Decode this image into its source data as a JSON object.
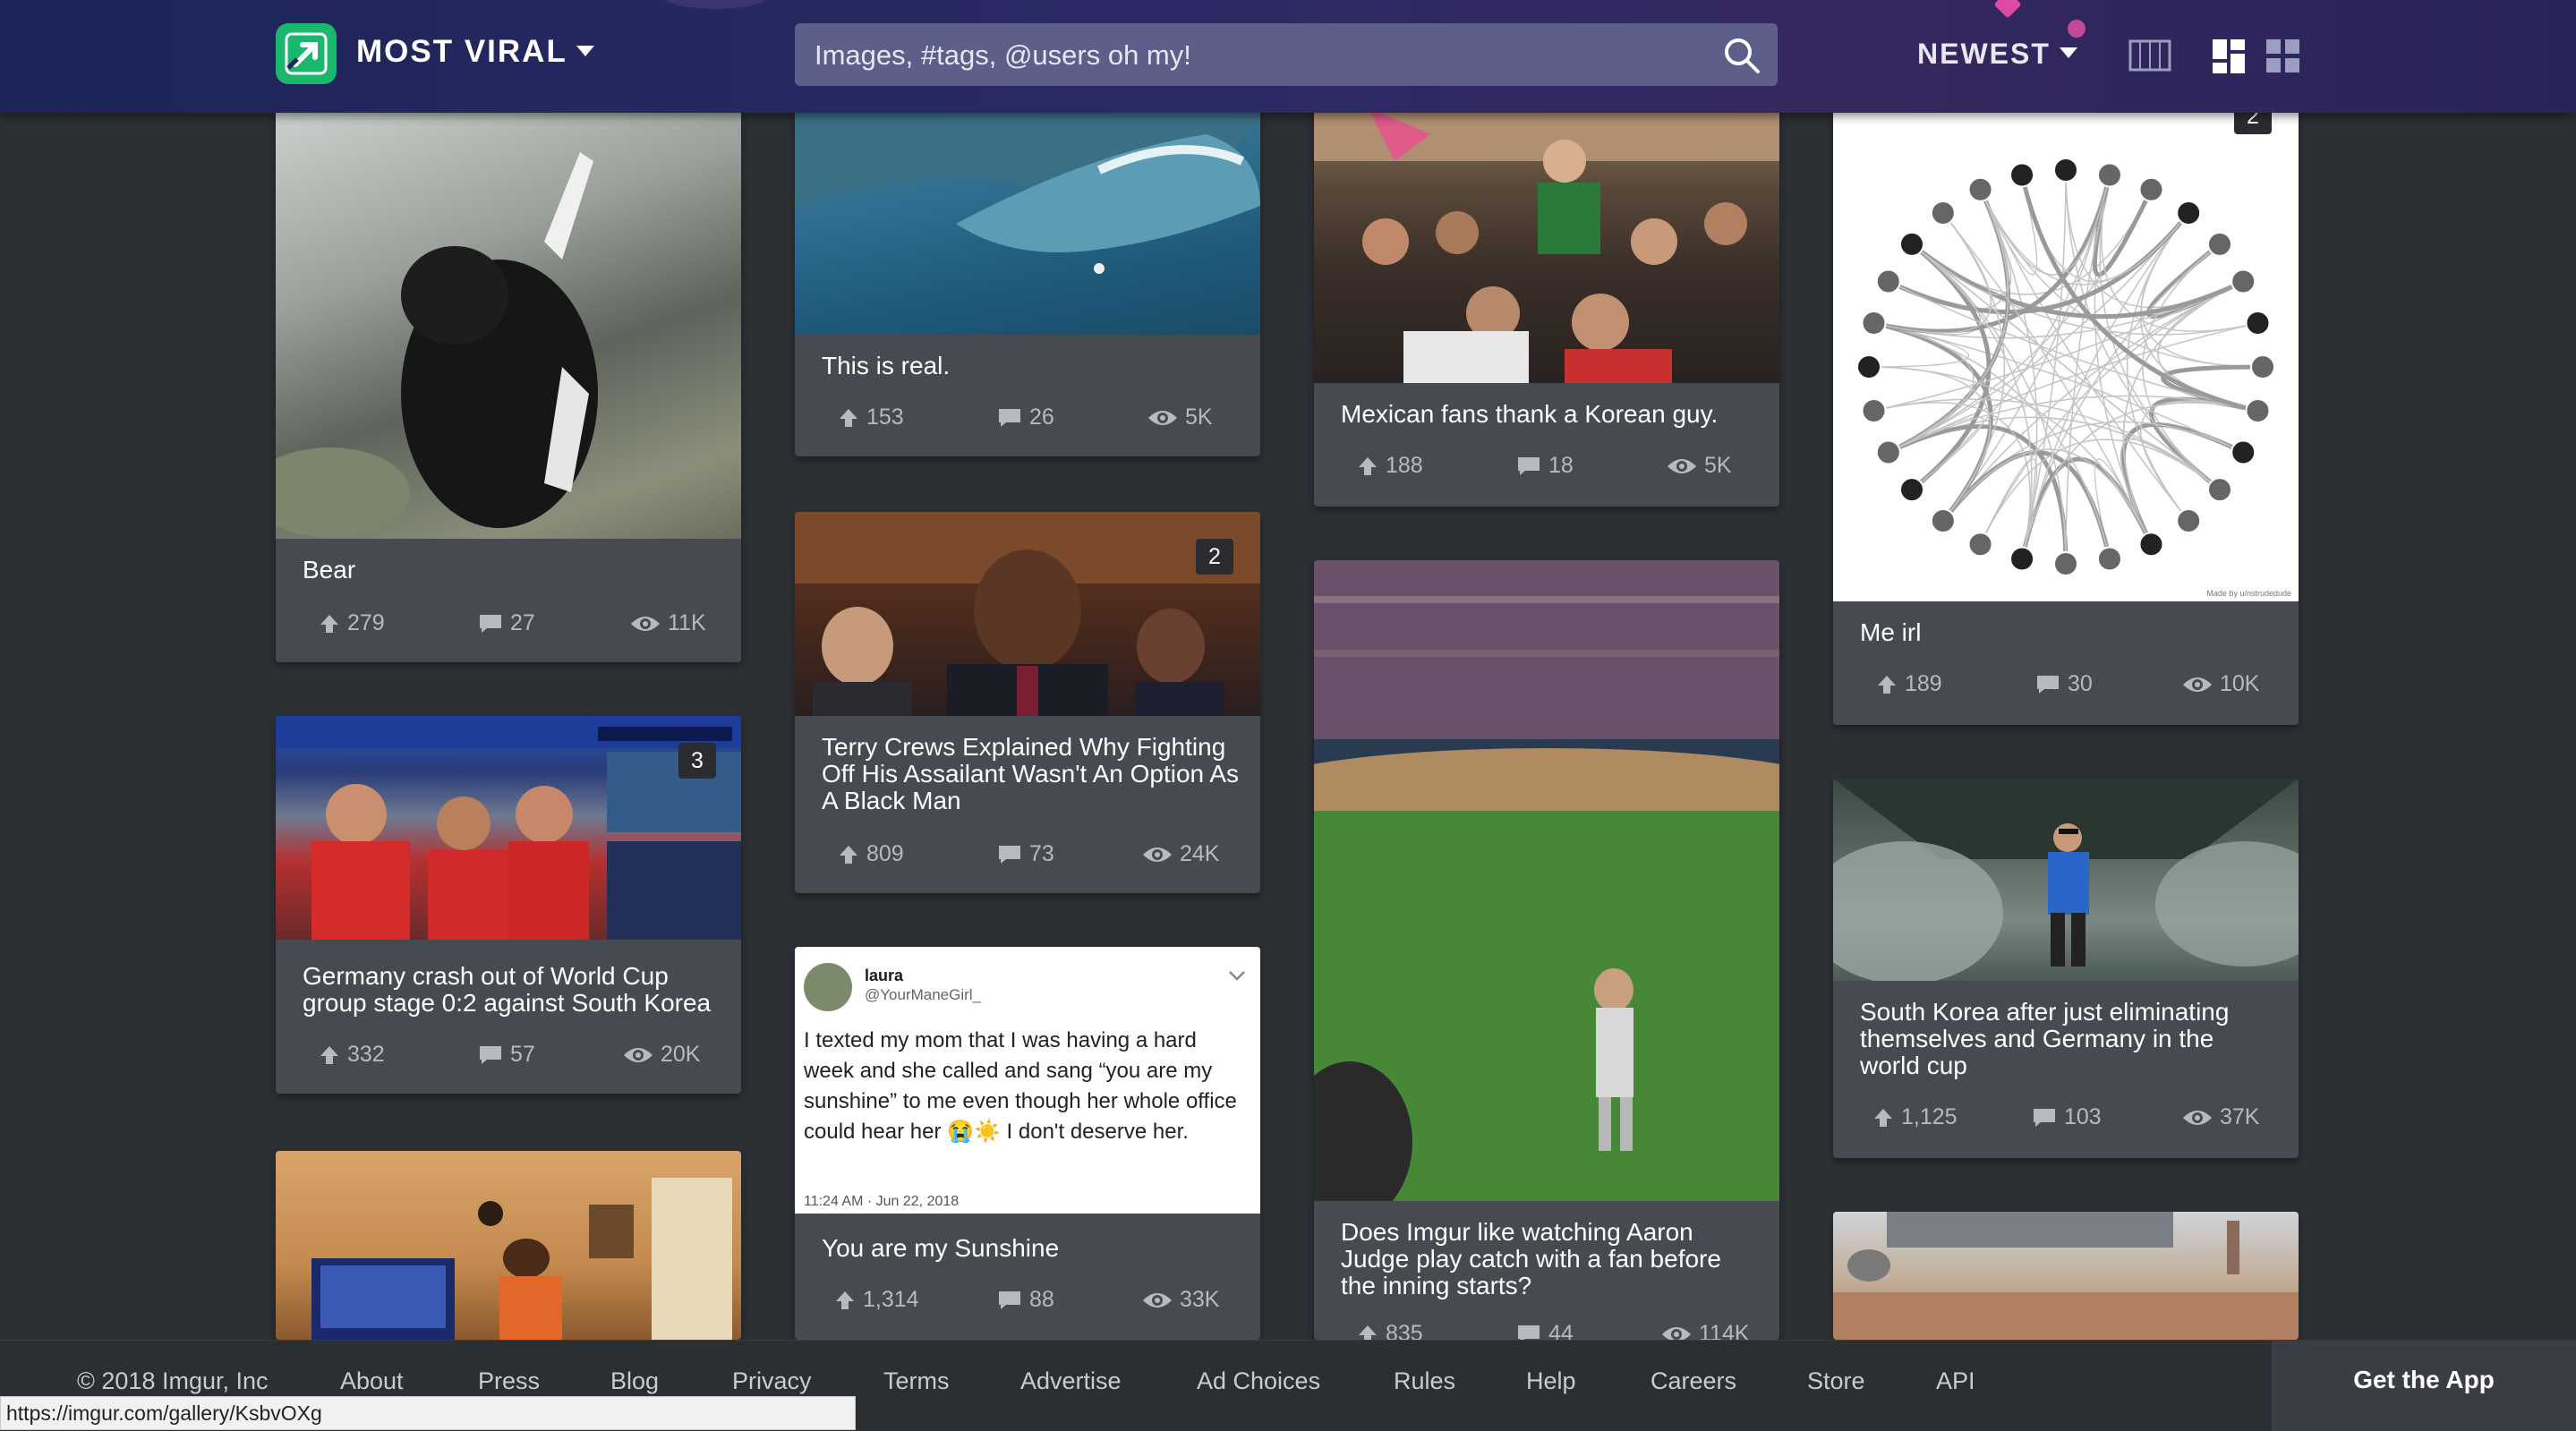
{
  "header": {
    "section_title": "MOST VIRAL",
    "search_placeholder": "Images, #tags, @users oh my!",
    "sort_label": "NEWEST"
  },
  "posts": [
    {
      "title": "Bear",
      "upvotes": "279",
      "comments": "27",
      "views": "11K"
    },
    {
      "title": "Germany crash out of World Cup group stage 0:2 against South Korea",
      "upvotes": "332",
      "comments": "57",
      "views": "20K",
      "badge": "3"
    },
    {
      "title": "This is real.",
      "upvotes": "153",
      "comments": "26",
      "views": "5K"
    },
    {
      "title": "Terry Crews Explained Why Fighting Off His Assailant Wasn't An Option As A Black Man",
      "upvotes": "809",
      "comments": "73",
      "views": "24K",
      "badge": "2"
    },
    {
      "title": "You are my Sunshine",
      "upvotes": "1,314",
      "comments": "88",
      "views": "33K",
      "tweet": {
        "name": "laura",
        "handle": "@YourManeGirl_",
        "text": "I texted my mom that I was having a hard week and she called and sang “you are my sunshine” to me even though her whole office could hear her 😭☀️ I don't deserve her.",
        "time": "11:24 AM · Jun 22, 2018"
      }
    },
    {
      "title": "Mexican fans thank a Korean guy.",
      "upvotes": "188",
      "comments": "18",
      "views": "5K"
    },
    {
      "title": "Does Imgur like watching Aaron Judge play catch with a fan before the inning starts?",
      "upvotes": "835",
      "comments": "44",
      "views": "114K"
    },
    {
      "title": "Me irl",
      "upvotes": "189",
      "comments": "30",
      "views": "10K",
      "badge": "2",
      "image_caption": "Made by u/nstrudedude"
    },
    {
      "title": "South Korea after just eliminating themselves and Germany in the world cup",
      "upvotes": "1,125",
      "comments": "103",
      "views": "37K"
    }
  ],
  "footer": {
    "copyright": "© 2018 Imgur, Inc",
    "links": [
      "About",
      "Press",
      "Blog",
      "Privacy",
      "Terms",
      "Advertise",
      "Ad Choices",
      "Rules",
      "Help",
      "Careers",
      "Store",
      "API"
    ],
    "get_app": "Get the App"
  },
  "status_url": "https://imgur.com/gallery/KsbvOXg",
  "colors": {
    "accent": "#1bb76e",
    "header": "#1c2557",
    "card": "#474a51",
    "background": "#2c2f34"
  }
}
